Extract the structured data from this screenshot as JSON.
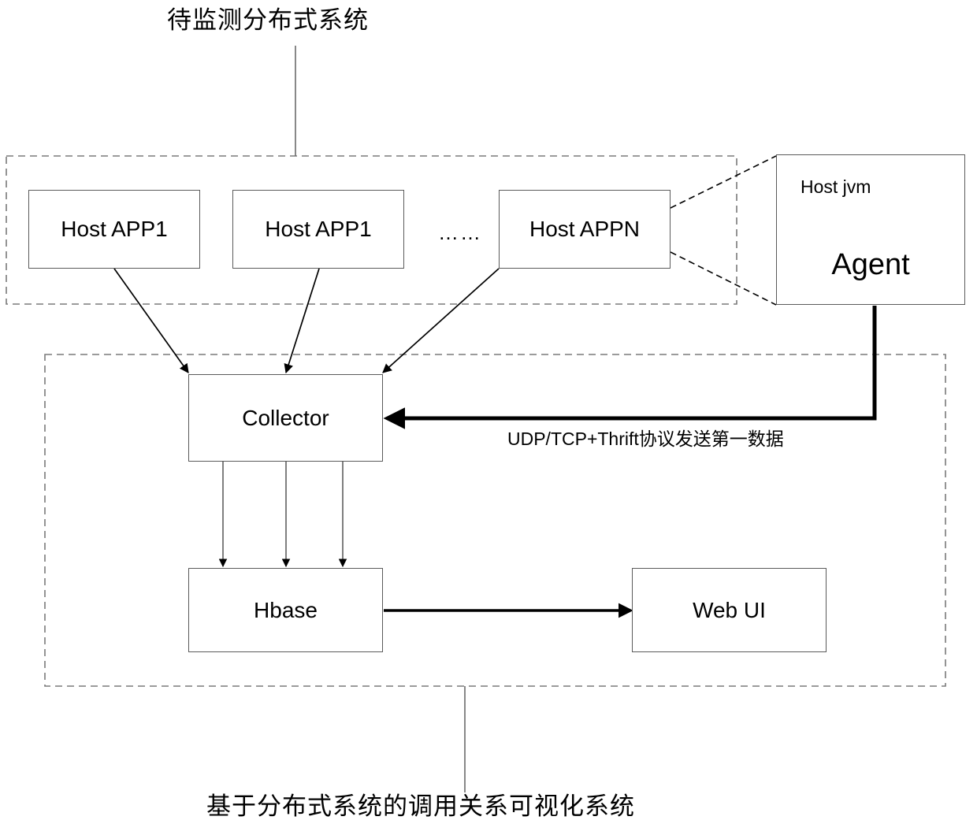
{
  "diagram": {
    "title_top": "待监测分布式系统",
    "title_bottom": "基于分布式系统的调用关系可视化系统",
    "ellipsis": "……",
    "protocol_label": "UDP/TCP+Thrift协议发送第一数据",
    "nodes": {
      "app1": "Host APP1",
      "app2": "Host APP1",
      "appn": "Host APPN",
      "agent_scope": "Host jvm",
      "agent": "Agent",
      "collector": "Collector",
      "hbase": "Hbase",
      "webui": "Web UI"
    },
    "colors": {
      "stroke": "#000000",
      "box_border": "#5a5a5a",
      "dashed_border": "#7a7a7a",
      "background": "#ffffff"
    }
  }
}
